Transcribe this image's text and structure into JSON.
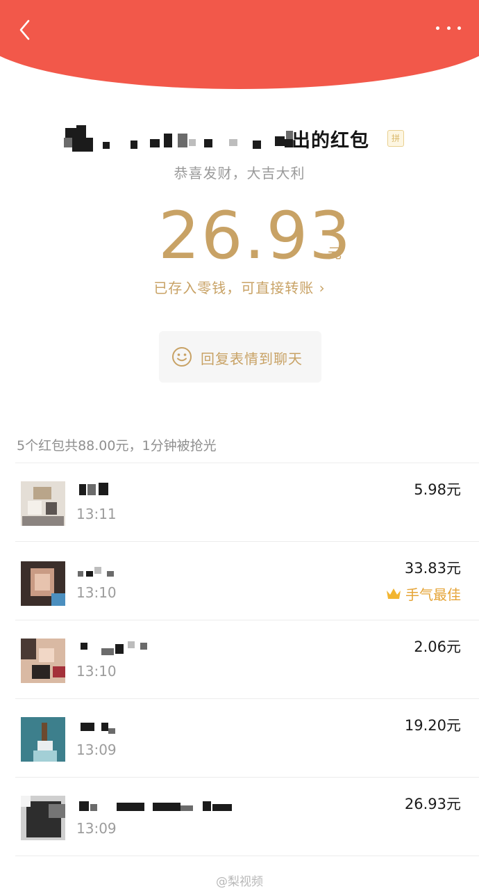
{
  "header": {
    "back_icon": "chevron-left-icon",
    "more_icon": "more-dots-icon",
    "color": "#f2584a"
  },
  "envelope": {
    "sender_suffix": "出的红包",
    "badge": "拼",
    "greeting": "恭喜发财，大吉大利",
    "amount": "26.93",
    "unit": "元",
    "saved_text": "已存入零钱，可直接转账 ›",
    "reply_button": "回复表情到聊天",
    "accent": "#c8a265"
  },
  "summary": "5个红包共88.00元，1分钟被抢光",
  "receivers": [
    {
      "time": "13:11",
      "amount": "5.98元"
    },
    {
      "time": "13:10",
      "amount": "33.83元",
      "badge": "手气最佳"
    },
    {
      "time": "13:10",
      "amount": "2.06元"
    },
    {
      "time": "13:09",
      "amount": "19.20元"
    },
    {
      "time": "13:09",
      "amount": "26.93元"
    }
  ],
  "watermark": "@梨视频"
}
